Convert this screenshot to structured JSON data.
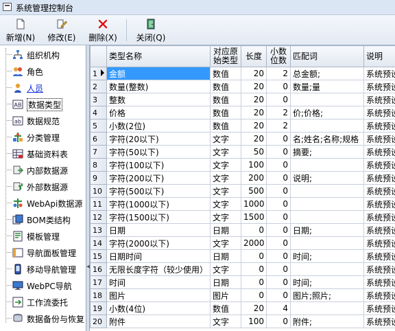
{
  "window": {
    "title": "系统管理控制台"
  },
  "toolbar": {
    "buttons": [
      {
        "label": "新增(N)",
        "icon": "new-document-icon"
      },
      {
        "label": "修改(E)",
        "icon": "edit-icon"
      },
      {
        "label": "删除(X)",
        "icon": "delete-x-icon"
      },
      {
        "label": "关闭(Q)",
        "icon": "close-door-icon"
      }
    ]
  },
  "tree": {
    "items": [
      {
        "label": "组织机构",
        "icon": "org-tree-icon"
      },
      {
        "label": "角色",
        "icon": "roles-icon"
      },
      {
        "label": "人员",
        "icon": "person-icon"
      },
      {
        "label": "数据类型",
        "icon": "data-type-icon"
      },
      {
        "label": "数据规范",
        "icon": "data-spec-icon"
      },
      {
        "label": "分类管理",
        "icon": "category-icon"
      },
      {
        "label": "基础资料表",
        "icon": "base-table-icon"
      },
      {
        "label": "内部数据源",
        "icon": "internal-source-icon"
      },
      {
        "label": "外部数据源",
        "icon": "external-source-icon"
      },
      {
        "label": "WebApi数据源",
        "icon": "webapi-icon"
      },
      {
        "label": "BOM类结构",
        "icon": "bom-icon"
      },
      {
        "label": "模板管理",
        "icon": "template-icon"
      },
      {
        "label": "导航面板管理",
        "icon": "nav-panel-icon"
      },
      {
        "label": "移动导航管理",
        "icon": "mobile-nav-icon"
      },
      {
        "label": "WebPC导航",
        "icon": "webpc-icon"
      },
      {
        "label": "工作流委托",
        "icon": "workflow-icon"
      },
      {
        "label": "数据备份与恢复",
        "icon": "backup-icon"
      }
    ]
  },
  "grid": {
    "columns": [
      "类型名称",
      "对应原始类型",
      "长度",
      "小数位数",
      "匹配词",
      "说明"
    ],
    "rows": [
      [
        "1",
        "金额",
        "数值",
        "20",
        "2",
        "总金额;",
        "系统预设"
      ],
      [
        "2",
        "数量(整数)",
        "数值",
        "20",
        "0",
        "数量;量",
        "系统预设"
      ],
      [
        "3",
        "整数",
        "数值",
        "20",
        "0",
        "",
        "系统预设"
      ],
      [
        "4",
        "价格",
        "数值",
        "20",
        "2",
        "价;价格;",
        "系统预设"
      ],
      [
        "5",
        "小数(2位)",
        "数值",
        "20",
        "2",
        "",
        "系统预设"
      ],
      [
        "6",
        "字符(20以下)",
        "文字",
        "20",
        "0",
        "名;姓名;名称;规格",
        "系统预设"
      ],
      [
        "7",
        "字符(50以下)",
        "文字",
        "50",
        "0",
        "摘要;",
        "系统预设"
      ],
      [
        "8",
        "字符(100以下)",
        "文字",
        "100",
        "0",
        "",
        "系统预设"
      ],
      [
        "9",
        "字符(200以下)",
        "文字",
        "200",
        "0",
        "说明;",
        "系统预设"
      ],
      [
        "10",
        "字符(500以下)",
        "文字",
        "500",
        "0",
        "",
        "系统预设"
      ],
      [
        "11",
        "字符(1000以下)",
        "文字",
        "1000",
        "0",
        "",
        "系统预设"
      ],
      [
        "12",
        "字符(1500以下)",
        "文字",
        "1500",
        "0",
        "",
        "系统预设"
      ],
      [
        "13",
        "日期",
        "日期",
        "0",
        "0",
        "日期;",
        "系统预设"
      ],
      [
        "14",
        "字符(2000以下)",
        "文字",
        "2000",
        "0",
        "",
        "系统预设"
      ],
      [
        "15",
        "日期时间",
        "日期",
        "0",
        "0",
        "时间;",
        "系统预设"
      ],
      [
        "16",
        "无限长度字符（较少使用）",
        "文字",
        "0",
        "0",
        "",
        "系统预设"
      ],
      [
        "17",
        "时间",
        "日期",
        "0",
        "0",
        "时间;",
        "系统预设"
      ],
      [
        "18",
        "图片",
        "图片",
        "0",
        "0",
        "图片;照片;",
        "系统预设"
      ],
      [
        "19",
        "小数(4位)",
        "数值",
        "20",
        "4",
        "",
        "系统预设"
      ],
      [
        "20",
        "附件",
        "文字",
        "100",
        "0",
        "附件;",
        "系统预设"
      ]
    ]
  }
}
